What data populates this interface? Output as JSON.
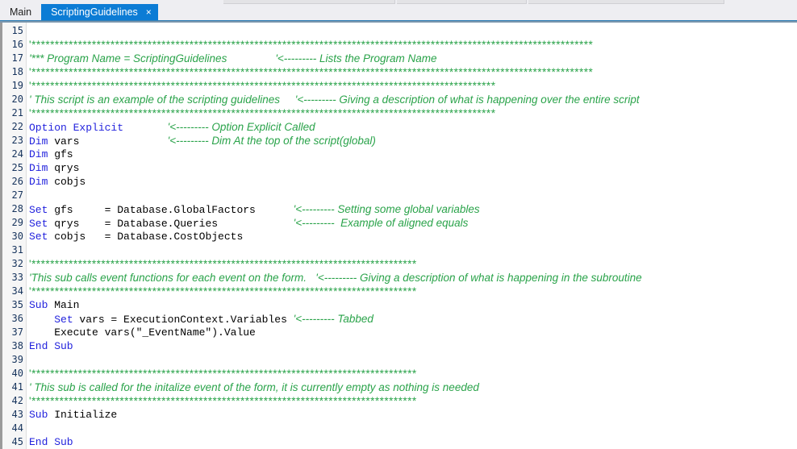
{
  "window": {
    "title": "ScriptingGuidelines",
    "colors": {
      "keyword": "#2222dd",
      "comment": "#2aa34a",
      "plain": "#000000",
      "active_tab_bg": "#0c7cd5",
      "gutter_bg": "#f6f6f6",
      "line_number": "#16335c",
      "toolbar_bg": "#eeeef2",
      "tab_underline": "#7a96ad"
    }
  },
  "tabs": [
    {
      "label": "Main",
      "active": false,
      "closable": false
    },
    {
      "label": "ScriptingGuidelines",
      "active": true,
      "closable": true,
      "close_glyph": "×"
    }
  ],
  "editor": {
    "first_line_number": 15,
    "lines": [
      {
        "number": 15,
        "tokens": []
      },
      {
        "number": 16,
        "tokens": [
          {
            "type": "stars",
            "text": "'*************************************************************************************************************************"
          }
        ]
      },
      {
        "number": 17,
        "tokens": [
          {
            "type": "comment",
            "text": "'*** Program Name = ScriptingGuidelines"
          },
          {
            "type": "comment",
            "text": "                '<--------- Lists the Program Name"
          }
        ]
      },
      {
        "number": 18,
        "tokens": [
          {
            "type": "stars",
            "text": "'*************************************************************************************************************************"
          }
        ]
      },
      {
        "number": 19,
        "tokens": [
          {
            "type": "stars",
            "text": "'****************************************************************************************************"
          }
        ]
      },
      {
        "number": 20,
        "tokens": [
          {
            "type": "comment",
            "text": "' This script is an example of the scripting guidelines"
          },
          {
            "type": "comment",
            "text": "     '<--------- Giving a description of what is happening over the entire script"
          }
        ]
      },
      {
        "number": 21,
        "tokens": [
          {
            "type": "stars",
            "text": "'****************************************************************************************************"
          }
        ]
      },
      {
        "number": 22,
        "tokens": [
          {
            "type": "keyword",
            "text": "Option Explicit"
          },
          {
            "type": "plain",
            "text": "       "
          },
          {
            "type": "comment",
            "text": "'<--------- Option Explicit Called"
          }
        ]
      },
      {
        "number": 23,
        "tokens": [
          {
            "type": "keyword",
            "text": "Dim"
          },
          {
            "type": "plain",
            "text": " vars              "
          },
          {
            "type": "comment",
            "text": "'<--------- Dim At the top of the script(global)"
          }
        ]
      },
      {
        "number": 24,
        "tokens": [
          {
            "type": "keyword",
            "text": "Dim"
          },
          {
            "type": "plain",
            "text": " gfs"
          }
        ]
      },
      {
        "number": 25,
        "tokens": [
          {
            "type": "keyword",
            "text": "Dim"
          },
          {
            "type": "plain",
            "text": " qrys"
          }
        ]
      },
      {
        "number": 26,
        "tokens": [
          {
            "type": "keyword",
            "text": "Dim"
          },
          {
            "type": "plain",
            "text": " cobjs"
          }
        ]
      },
      {
        "number": 27,
        "tokens": []
      },
      {
        "number": 28,
        "tokens": [
          {
            "type": "keyword",
            "text": "Set"
          },
          {
            "type": "plain",
            "text": " gfs     = Database.GlobalFactors      "
          },
          {
            "type": "comment",
            "text": "'<--------- Setting some global variables"
          }
        ]
      },
      {
        "number": 29,
        "tokens": [
          {
            "type": "keyword",
            "text": "Set"
          },
          {
            "type": "plain",
            "text": " qrys    = Database.Queries            "
          },
          {
            "type": "comment",
            "text": "'<---------  Example of aligned equals"
          }
        ]
      },
      {
        "number": 30,
        "tokens": [
          {
            "type": "keyword",
            "text": "Set"
          },
          {
            "type": "plain",
            "text": " cobjs   = Database.CostObjects"
          }
        ]
      },
      {
        "number": 31,
        "tokens": []
      },
      {
        "number": 32,
        "tokens": [
          {
            "type": "stars",
            "text": "'***********************************************************************************"
          }
        ]
      },
      {
        "number": 33,
        "tokens": [
          {
            "type": "comment",
            "text": "'This sub calls event functions for each event on the form."
          },
          {
            "type": "comment",
            "text": "   '<--------- Giving a description of what is happening in the subroutine"
          }
        ]
      },
      {
        "number": 34,
        "tokens": [
          {
            "type": "stars",
            "text": "'***********************************************************************************"
          }
        ]
      },
      {
        "number": 35,
        "tokens": [
          {
            "type": "keyword",
            "text": "Sub"
          },
          {
            "type": "plain",
            "text": " Main"
          }
        ]
      },
      {
        "number": 36,
        "tokens": [
          {
            "type": "plain",
            "text": "    "
          },
          {
            "type": "keyword",
            "text": "Set"
          },
          {
            "type": "plain",
            "text": " vars = ExecutionContext.Variables "
          },
          {
            "type": "comment",
            "text": "'<--------- Tabbed"
          }
        ]
      },
      {
        "number": 37,
        "tokens": [
          {
            "type": "plain",
            "text": "    Execute vars(\"_EventName\").Value"
          }
        ]
      },
      {
        "number": 38,
        "tokens": [
          {
            "type": "keyword",
            "text": "End Sub"
          }
        ]
      },
      {
        "number": 39,
        "tokens": []
      },
      {
        "number": 40,
        "tokens": [
          {
            "type": "stars",
            "text": "'***********************************************************************************"
          }
        ]
      },
      {
        "number": 41,
        "tokens": [
          {
            "type": "comment",
            "text": "' This sub is called for the initalize event of the form, it is currently empty as nothing is needed"
          }
        ]
      },
      {
        "number": 42,
        "tokens": [
          {
            "type": "stars",
            "text": "'***********************************************************************************"
          }
        ]
      },
      {
        "number": 43,
        "tokens": [
          {
            "type": "keyword",
            "text": "Sub"
          },
          {
            "type": "plain",
            "text": " Initialize"
          }
        ]
      },
      {
        "number": 44,
        "tokens": []
      },
      {
        "number": 45,
        "tokens": [
          {
            "type": "keyword",
            "text": "End Sub"
          }
        ]
      }
    ]
  }
}
